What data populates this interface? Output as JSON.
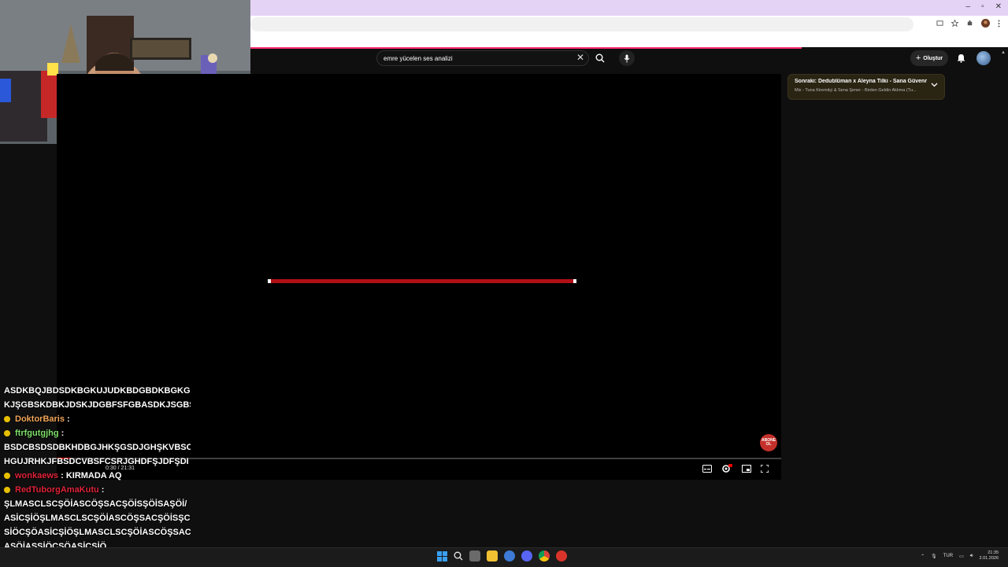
{
  "window": {
    "minimize_glyph": "–",
    "maximize_glyph": "▫",
    "close_glyph": "✕"
  },
  "search": {
    "query": "emre yücelen ses analizi",
    "clear_glyph": "✕"
  },
  "header": {
    "create_label": "Oluştur"
  },
  "up_next": {
    "label": "Sonraki: Dedublüman x Aleyna Tilki - Sana Güvenmi...",
    "subtitle": "Mix - Tuna Kiremitçi & Sena Şener - Birden Geldin Aklıma (Tu..."
  },
  "player": {
    "time": "0:30 / 21:31",
    "progress_fraction": 0.02,
    "subscribe_badge": "ABONE OL"
  },
  "chat": {
    "messages": [
      {
        "user": "",
        "text": "ASDKBQJBDSDKBGKUJUDKBDGBDKBGKGBGBGB"
      },
      {
        "user": "",
        "text": "KJŞGBSKDBKJDSKJDGBFSFGBASDKJSGBS"
      },
      {
        "user": "DoktorBaris",
        "text": "",
        "color": "#f2a65a"
      },
      {
        "user": "ftrfgutgjhg",
        "text": "",
        "color": "#7ee06a"
      },
      {
        "user": "",
        "text": "BSDCBSDSDBKHDBGJHKŞGSDJGHŞKVBSC"
      },
      {
        "user": "",
        "text": "HGUJRHKJFBSDCVBSFCSRJGHDFŞJDFŞDI"
      },
      {
        "user": "wonkaews",
        "text": "KIRMADA AQ",
        "color": "#e0243a"
      },
      {
        "user": "RedTuborgAmaKutu",
        "text": "",
        "color": "#e0243a"
      },
      {
        "user": "",
        "text": "ŞLMASCLSCŞÖİASCÖŞSACŞÖİSŞÖİSAŞÖİ/"
      },
      {
        "user": "",
        "text": "ASİCŞİÖŞLMASCLSCŞÖİASCÖŞSACŞÖİSŞC"
      },
      {
        "user": "",
        "text": "SİÖCŞÖASİCŞİÖŞLMASCLSCŞÖİASCÖŞSAC"
      },
      {
        "user": "",
        "text": "ASÖİAŞSİÖCŞÖASİCŞİÖ"
      }
    ]
  },
  "taskbar": {
    "tray_lang": "TUR",
    "clock_time": "21:35",
    "clock_date": "2.01.2026"
  }
}
